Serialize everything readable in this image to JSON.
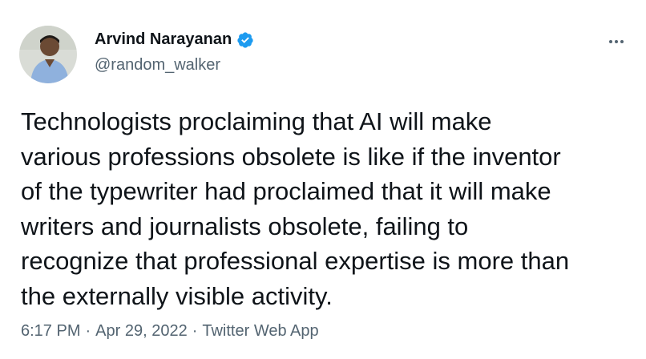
{
  "author": {
    "display_name": "Arvind Narayanan",
    "handle": "@random_walker",
    "verified": true
  },
  "tweet": {
    "text": "Technologists proclaiming that AI will make\nvarious professions obsolete is like if the inventor\nof the typewriter had proclaimed that it will make\nwriters and journalists obsolete, failing to\nrecognize that professional expertise is more than\nthe externally visible activity."
  },
  "meta": {
    "time": "6:17 PM",
    "separator": "·",
    "date": "Apr 29, 2022",
    "source": "Twitter Web App"
  },
  "icons": {
    "verified": "verified-badge-icon",
    "more": "more-options-icon"
  },
  "colors": {
    "verified_blue": "#1d9bf0",
    "secondary_text": "#536471",
    "primary_text": "#0f1419"
  }
}
